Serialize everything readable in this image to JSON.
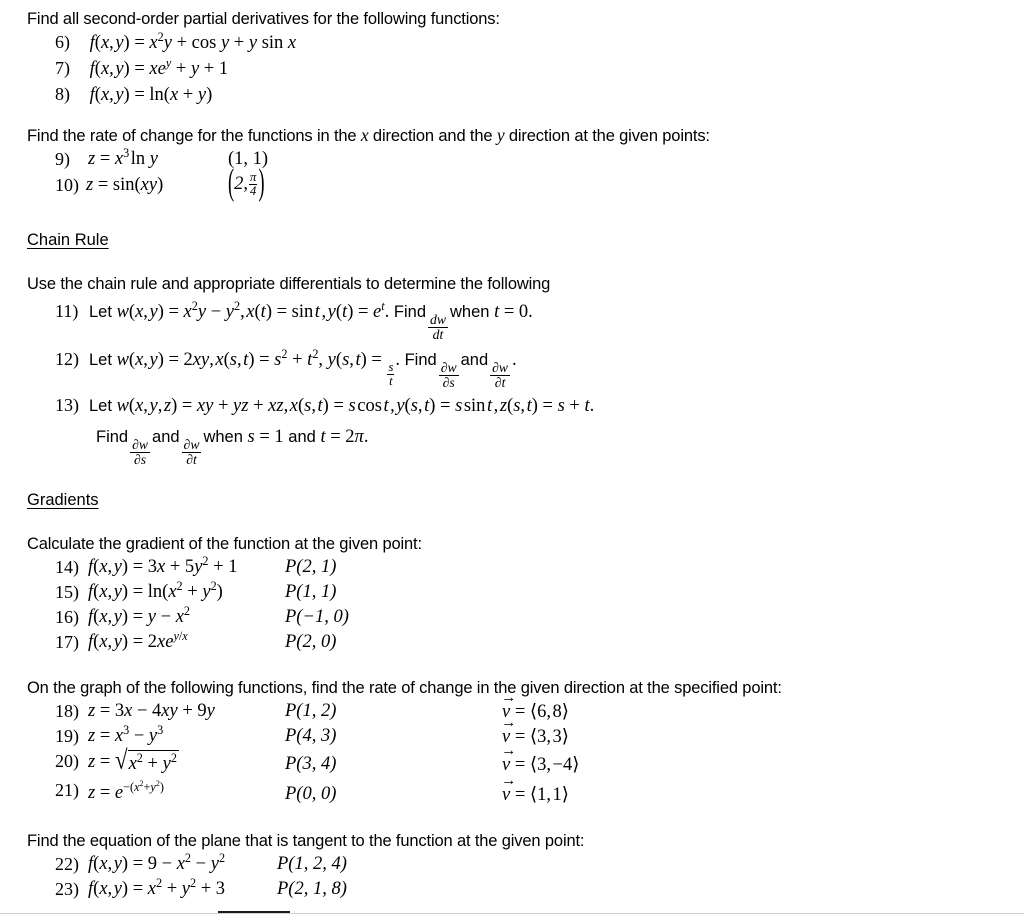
{
  "document": {
    "title": "Partial Derivatives, Chain Rule and Gradients Worksheet",
    "background_color": "#ffffff",
    "text_color": "#000000"
  },
  "sections": [
    {
      "id": "second-order-partials",
      "heading": null,
      "prompt": "Find all second-order partial derivatives for the following functions:",
      "problems": [
        {
          "number": "6)",
          "function": "f(x, y) = x²y + cos y + y sin x"
        },
        {
          "number": "7)",
          "function": "f(x, y) = xeʸ + y + 1"
        },
        {
          "number": "8)",
          "function": "f(x, y) = ln(x + y)"
        }
      ]
    },
    {
      "id": "rate-of-change",
      "heading": null,
      "prompt_parts": {
        "a": "Find the rate of change for the functions in the ",
        "var1": "x",
        "b": " direction and the ",
        "var2": "y",
        "c": " direction at the given points:"
      },
      "prompt": "Find the rate of change for the functions in the x direction and the y direction at the given points:",
      "problems": [
        {
          "number": "9)",
          "function": "z = x³ ln y",
          "point": "(1, 1)"
        },
        {
          "number": "10)",
          "function": "z = sin(xy)",
          "point": "(2, π/4)"
        }
      ]
    },
    {
      "id": "chain-rule",
      "heading": "Chain Rule",
      "prompt": "Use the chain rule and appropriate differentials to determine the following",
      "problems": [
        {
          "number": "11)",
          "text": "Let w(x, y) = x²y − y², x(t) = sin t , y(t) = eᵗ. Find dw/dt when t = 0."
        },
        {
          "number": "12)",
          "text": "Let w(x, y) = 2xy, x(s, t) = s² + t², y(s, t) = s/t. Find ∂w/∂s and ∂w/∂t."
        },
        {
          "number": "13)",
          "text": "Let w(x, y, z) = xy + yz + xz, x(s, t) = s cos t , y(s, t) = s sin t , z(s, t) = s + t.",
          "text_line2": "Find ∂w/∂s and ∂w/∂t when s = 1 and t = 2π."
        }
      ]
    },
    {
      "id": "gradients",
      "heading": "Gradients",
      "prompt": "Calculate the gradient of the function at the given point:",
      "problems": [
        {
          "number": "14)",
          "function": "f(x, y) = 3x + 5y² + 1",
          "point": "P(2, 1)"
        },
        {
          "number": "15)",
          "function": "f(x, y) = ln(x² + y²)",
          "point": "P(1, 1)"
        },
        {
          "number": "16)",
          "function": "f(x, y) = y − x²",
          "point": "P(−1, 0)"
        },
        {
          "number": "17)",
          "function": "f(x, y) = 2xeʸᐟˣ",
          "point": "P(2, 0)"
        }
      ]
    },
    {
      "id": "directional-derivative",
      "heading": null,
      "prompt": "On the graph of the following functions, find the rate of change in the given direction at the specified point:",
      "problems": [
        {
          "number": "18)",
          "function": "z = 3x − 4xy + 9y",
          "point": "P(1, 2)",
          "vector": "v⃗ = ⟨6, 8⟩"
        },
        {
          "number": "19)",
          "function": "z = x³ − y³",
          "point": "P(4, 3)",
          "vector": "v⃗ = ⟨3, 3⟩"
        },
        {
          "number": "20)",
          "function": "z = √(x² + y²)",
          "point": "P(3, 4)",
          "vector": "v⃗ = ⟨3, −4⟩"
        },
        {
          "number": "21)",
          "function": "z = e⁻⁽ˣ²⁺ʸ²⁾",
          "point": "P(0, 0)",
          "vector": "v⃗ = ⟨1, 1⟩"
        }
      ]
    },
    {
      "id": "tangent-plane",
      "heading": null,
      "prompt": "Find the equation of the plane that is tangent to the function at the given point:",
      "problems": [
        {
          "number": "22)",
          "function": "f(x, y) = 9 − x² − y²",
          "point": "P(1, 2, 4)"
        },
        {
          "number": "23)",
          "function": "f(x, y) = x² + y² + 3",
          "point": "P(2, 1, 8)"
        }
      ]
    }
  ],
  "labels": {
    "prompt_1": "Find all second-order partial derivatives for the following functions:",
    "prompt_2_a": "Find the rate of change for the functions in the ",
    "prompt_2_x": "x",
    "prompt_2_b": " direction and the ",
    "prompt_2_y": "y",
    "prompt_2_c": " direction at the given points:",
    "heading_chain": "Chain Rule",
    "prompt_3": "Use the chain rule and appropriate differentials to determine the following",
    "heading_gradients": "Gradients",
    "prompt_4": "Calculate the gradient of the function at the given point:",
    "prompt_5": "On the graph of the following functions, find the rate of change in the given direction at the specified point:",
    "prompt_6": "Find the equation of the plane that is tangent to the function at the given point:",
    "num_6": "6)",
    "num_7": "7)",
    "num_8": "8)",
    "num_9": "9)",
    "num_10": "10)",
    "num_11": "11)",
    "num_12": "12)",
    "num_13": "13)",
    "num_14": "14)",
    "num_15": "15)",
    "num_16": "16)",
    "num_17": "17)",
    "num_18": "18)",
    "num_19": "19)",
    "num_20": "20)",
    "num_21": "21)",
    "num_22": "22)",
    "num_23": "23)",
    "pt_9": "(1, 1)",
    "pt_14": "P(2, 1)",
    "pt_15": "P(1, 1)",
    "pt_16": "P(−1, 0)",
    "pt_17": "P(2, 0)",
    "pt_18": "P(1, 2)",
    "pt_19": "P(4, 3)",
    "pt_20": "P(3, 4)",
    "pt_21": "P(0, 0)",
    "pt_22": "P(1, 2, 4)",
    "pt_23": "P(2, 1, 8)",
    "let_word": "Let",
    "find_word": "Find",
    "and_word": "and",
    "when_word": "when"
  }
}
